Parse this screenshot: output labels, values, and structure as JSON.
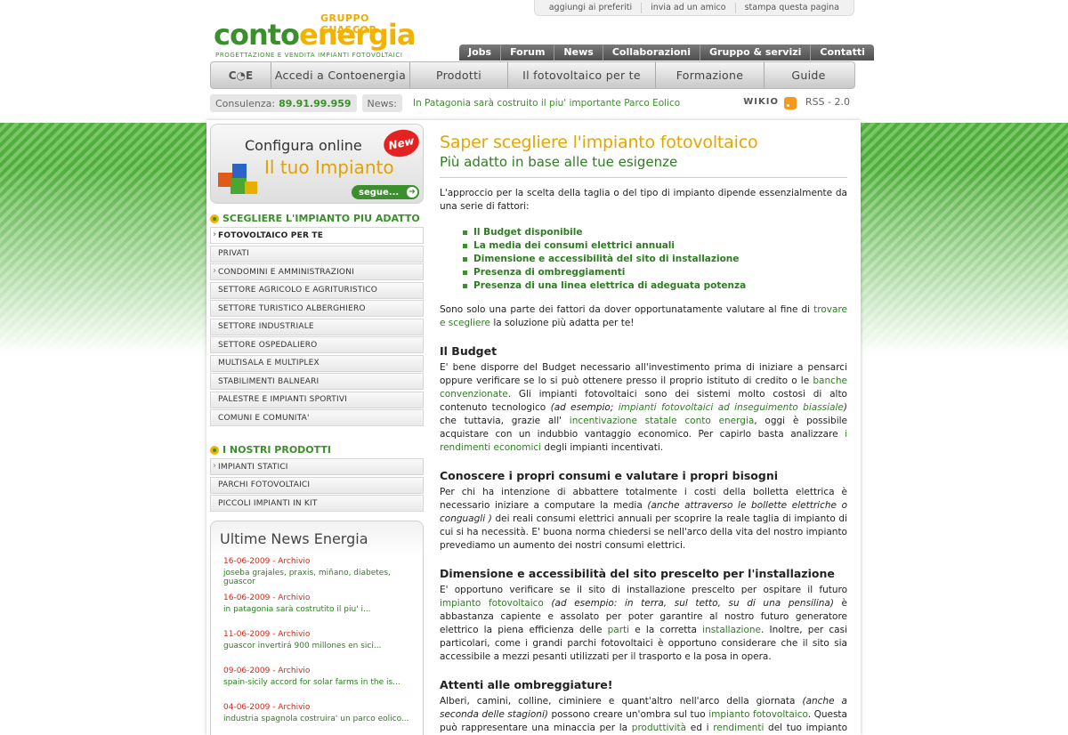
{
  "util_links": [
    "aggiungi ai preferiti",
    "invia ad un amico",
    "stampa questa pagina"
  ],
  "logo": {
    "gruppo": "GRUPPO GUASCOR",
    "conto": "conto",
    "energia": "energia",
    "tagline": "PROGETTAZIONE E VENDITA IMPIANTI FOTOVOLTAICI"
  },
  "topnav": [
    "Jobs",
    "Forum",
    "News",
    "Collaborazioni",
    "Gruppo & servizi",
    "Contatti"
  ],
  "mainnav": {
    "home": "C◔E",
    "items": [
      "Accedi a Contoenergia",
      "Prodotti",
      "Il fotovoltaico per te",
      "Formazione",
      "Guide"
    ]
  },
  "infobar": {
    "consulenza_label": "Consulenza:",
    "consulenza_number": "89.91.99.959",
    "news_label": "News:",
    "news_text": "In Patagonia sarà costruito il piu' importante Parco Eolico",
    "wikio": "WIKIO",
    "rss": "RSS - 2.0"
  },
  "promo": {
    "line1": "Configura online",
    "line2": "Il tuo Impianto",
    "badge": "New",
    "button": "segue..."
  },
  "sidebar": {
    "section1_title": "SCEGLIERE L'IMPIANTO PIU ADATTO",
    "section1_items": [
      "FOTOVOLTAICO PER TE",
      "PRIVATI",
      "CONDOMINI E AMMINISTRAZIONI",
      "SETTORE AGRICOLO E AGRITURISTICO",
      "SETTORE TURISTICO ALBERGHIERO",
      "SETTORE INDUSTRIALE",
      "SETTORE OSPEDALIERO",
      "MULTISALA E MULTIPLEX",
      "STABILIMENTI BALNEARI",
      "PALESTRE E IMPIANTI SPORTIVI",
      "COMUNI E COMUNITA'"
    ],
    "section2_title": "I NOSTRI PRODOTTI",
    "section2_items": [
      "IMPIANTI STATICI",
      "PARCHI FOTOVOLTAICI",
      "PICCOLI IMPIANTI IN KIT"
    ]
  },
  "newsbox": {
    "title": "Ultime News Energia",
    "items": [
      {
        "date": "16-06-2009 - Archivio",
        "title": "joseba grajales, praxis, miñano, diabetes, guascor"
      },
      {
        "date": "16-06-2009 - Archivio",
        "title": "in patagonia sarà costrutito il piu' i..."
      },
      {
        "date": "11-06-2009 - Archivio",
        "title": "guascor invertirá 900 millones en sici..."
      },
      {
        "date": "09-06-2009 - Archivio",
        "title": "spain-sicily accord for solar farms in the is..."
      },
      {
        "date": "04-06-2009 - Archivio",
        "title": "industria spagnola costruira' un parco eolico..."
      }
    ]
  },
  "main": {
    "title": "Saper scegliere l'impianto fotovoltaico",
    "subtitle": "Più adatto in base alle tue esigenze",
    "intro": "L'approccio per la scelta della taglia o del tipo di impianto dipende essenzialmente da una serie di fattori:",
    "bullets": [
      "Il Budget disponibile",
      "La media dei consumi elettrici annuali",
      "Dimensione e accessibilità del sito di installazione",
      "Presenza di ombreggiamenti",
      "Presenza di una linea elettrica di adeguata potenza"
    ],
    "after_bullets_1": "Sono solo una parte dei fattori da dover opportunatamente valutare al fine di ",
    "after_bullets_link": "trovare e scegliere",
    "after_bullets_2": " la soluzione più adatta per te!",
    "h_budget": "Il Budget",
    "budget_1": "E' bene disporre del Budget necessario all'investimento prima di iniziare a pensarci oppure verificare se lo si può ottenere presso il proprio istituto di credito o le ",
    "budget_link1": "banche convenzionate",
    "budget_2": ". Gli impianti fotovoltaici sono dei sistemi molto costosi di alto contenuto tecnologico ",
    "budget_em1": "(ad esempio; ",
    "budget_link2": "impianti fotovoltaici ad inseguimento biassiale",
    "budget_em2": ")",
    "budget_3": " che tuttavia, grazie all' ",
    "budget_link3": "incentivazione statale conto energia",
    "budget_4": ", oggi è possibile acquistare con un indubbio vantaggio economico. Per capirlo basta analizzare ",
    "budget_link4": "i rendimenti economici",
    "budget_5": " degli impianti incentivati.",
    "h_consumi": "Conoscere i propri consumi e valutare i propri bisogni",
    "consumi_1": "Per chi ha intenzione di abbattere totalmente i costi della bolletta elettrica è necessario iniziare a computare la media ",
    "consumi_em": "(anche attraverso le bollette elettriche o conguagli )",
    "consumi_2": " dei reali consumi elettrici annuali per scoprire la reale taglia di impianto di cui si ha necessità. E' buona norma chiedersi se nell'arco della vita del nostro impianto prevediamo un aumento dei nostri consumi elettrici.",
    "h_sito": "Dimensione e accessibilità del sito prescelto per l'installazione",
    "sito_1": "E' opportuno verificare se il sito di installazione prescelto per ospitare il futuro ",
    "sito_link1": "impianto fotovoltaico",
    "sito_em": " (ad esempio: in terra, sul tetto, su di una pensilina)",
    "sito_2": " è abbastanza capiente e assolato per poter garantire al nostro futuro generatore elettrico la piena efficienza delle ",
    "sito_link2": "parti",
    "sito_3": " e la corretta ",
    "sito_link3": "installazione",
    "sito_4": ". Inoltre, per casi particolari, come i grandi parchi fotovoltaici è opportuno considerare che il sito sia accessibile a mezzi pesanti utilizzati per il trasporto e la posa in opera.",
    "h_ombre": "Attenti alle ombreggiature!",
    "ombre_1": "Alberi, camini, colline, ciminiere e quant'altro nell'arco della giornata ",
    "ombre_em": "(anche a seconda delle stagioni)",
    "ombre_2": " possono creare un'ombra sul tuo ",
    "ombre_link1": "impianto fotovoltaico",
    "ombre_3": ". Questa può rappresentare una minaccia per la ",
    "ombre_link2": "produttività",
    "ombre_4": " ed i ",
    "ombre_link3": "rendimenti",
    "ombre_5": " del tuo impianto fotovoltaico. E' quindi buona prassi verificare questa importante situazione monitorando"
  }
}
